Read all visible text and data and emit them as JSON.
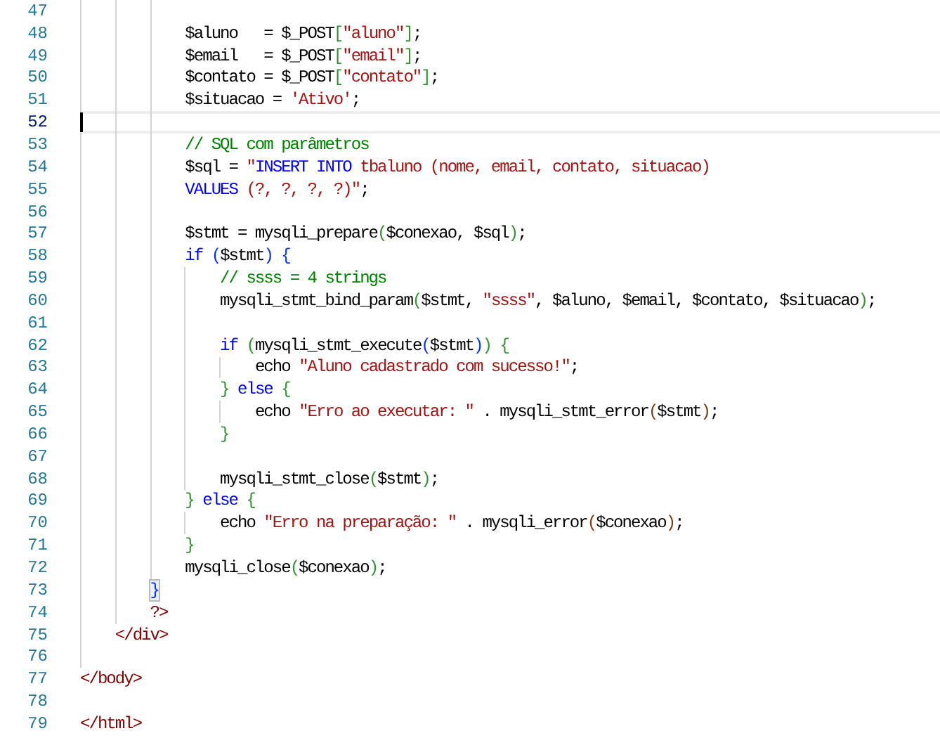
{
  "editor": {
    "lines": [
      {
        "number": "47",
        "current": false
      },
      {
        "number": "48",
        "current": false,
        "tokens": [
          {
            "text": "            $aluno   = $_POST",
            "kind": "plain"
          },
          {
            "text": "[",
            "kind": "bracket2"
          },
          {
            "text": "\"aluno\"",
            "kind": "string"
          },
          {
            "text": "]",
            "kind": "bracket2"
          },
          {
            "text": ";",
            "kind": "plain"
          }
        ]
      },
      {
        "number": "49",
        "current": false,
        "tokens": [
          {
            "text": "            $email   = $_POST",
            "kind": "plain"
          },
          {
            "text": "[",
            "kind": "bracket2"
          },
          {
            "text": "\"email\"",
            "kind": "string"
          },
          {
            "text": "]",
            "kind": "bracket2"
          },
          {
            "text": ";",
            "kind": "plain"
          }
        ]
      },
      {
        "number": "50",
        "current": false,
        "tokens": [
          {
            "text": "            $contato = $_POST",
            "kind": "plain"
          },
          {
            "text": "[",
            "kind": "bracket2"
          },
          {
            "text": "\"contato\"",
            "kind": "string"
          },
          {
            "text": "]",
            "kind": "bracket2"
          },
          {
            "text": ";",
            "kind": "plain"
          }
        ]
      },
      {
        "number": "51",
        "current": false,
        "tokens": [
          {
            "text": "            $situacao = ",
            "kind": "plain"
          },
          {
            "text": "'Ativo'",
            "kind": "string"
          },
          {
            "text": ";",
            "kind": "plain"
          }
        ]
      },
      {
        "number": "52",
        "current": true
      },
      {
        "number": "53",
        "current": false,
        "tokens": [
          {
            "text": "            // SQL com parâmetros",
            "kind": "comment"
          }
        ]
      },
      {
        "number": "54",
        "current": false,
        "tokens": [
          {
            "text": "            $sql = ",
            "kind": "plain"
          },
          {
            "text": "\"",
            "kind": "string"
          },
          {
            "text": "INSERT INTO",
            "kind": "keyword"
          },
          {
            "text": " tbaluno (nome, email, contato, situacao)",
            "kind": "string"
          }
        ]
      },
      {
        "number": "55",
        "current": false,
        "tokens": [
          {
            "text": "            VALUES",
            "kind": "keyword"
          },
          {
            "text": " (?, ?, ?, ?)\"",
            "kind": "string"
          },
          {
            "text": ";",
            "kind": "plain"
          }
        ]
      },
      {
        "number": "56",
        "current": false
      },
      {
        "number": "57",
        "current": false,
        "tokens": [
          {
            "text": "            $stmt = mysqli_prepare",
            "kind": "plain"
          },
          {
            "text": "(",
            "kind": "bracket2"
          },
          {
            "text": "$conexao, $sql",
            "kind": "plain"
          },
          {
            "text": ")",
            "kind": "bracket2"
          },
          {
            "text": ";",
            "kind": "plain"
          }
        ]
      },
      {
        "number": "58",
        "current": false,
        "tokens": [
          {
            "text": "            if ",
            "kind": "keyword"
          },
          {
            "text": "(",
            "kind": "bracket1"
          },
          {
            "text": "$stmt",
            "kind": "plain"
          },
          {
            "text": ")",
            "kind": "bracket1"
          },
          {
            "text": " {",
            "kind": "bracket1"
          }
        ]
      },
      {
        "number": "59",
        "current": false,
        "tokens": [
          {
            "text": "                // ssss = 4 strings",
            "kind": "comment"
          }
        ]
      },
      {
        "number": "60",
        "current": false,
        "tokens": [
          {
            "text": "                mysqli_stmt_bind_param",
            "kind": "plain"
          },
          {
            "text": "(",
            "kind": "bracket2"
          },
          {
            "text": "$stmt, ",
            "kind": "plain"
          },
          {
            "text": "\"ssss\"",
            "kind": "string"
          },
          {
            "text": ", $aluno, $email, $contato, $situacao",
            "kind": "plain"
          },
          {
            "text": ")",
            "kind": "bracket2"
          },
          {
            "text": ";",
            "kind": "plain"
          }
        ]
      },
      {
        "number": "61",
        "current": false
      },
      {
        "number": "62",
        "current": false,
        "tokens": [
          {
            "text": "                if ",
            "kind": "keyword"
          },
          {
            "text": "(",
            "kind": "bracket2"
          },
          {
            "text": "mysqli_stmt_execute",
            "kind": "plain"
          },
          {
            "text": "(",
            "kind": "bracket1"
          },
          {
            "text": "$stmt",
            "kind": "plain"
          },
          {
            "text": ")",
            "kind": "bracket1"
          },
          {
            "text": ")",
            "kind": "bracket2"
          },
          {
            "text": " {",
            "kind": "bracket2"
          }
        ]
      },
      {
        "number": "63",
        "current": false,
        "tokens": [
          {
            "text": "                    echo ",
            "kind": "plain"
          },
          {
            "text": "\"Aluno cadastrado com sucesso!\"",
            "kind": "string"
          },
          {
            "text": ";",
            "kind": "plain"
          }
        ]
      },
      {
        "number": "64",
        "current": false,
        "tokens": [
          {
            "text": "                }",
            "kind": "bracket2"
          },
          {
            "text": " else ",
            "kind": "keyword"
          },
          {
            "text": "{",
            "kind": "bracket2"
          }
        ]
      },
      {
        "number": "65",
        "current": false,
        "tokens": [
          {
            "text": "                    echo ",
            "kind": "plain"
          },
          {
            "text": "\"Erro ao executar: \"",
            "kind": "string"
          },
          {
            "text": " . mysqli_stmt_error",
            "kind": "plain"
          },
          {
            "text": "(",
            "kind": "bracket3"
          },
          {
            "text": "$stmt",
            "kind": "plain"
          },
          {
            "text": ")",
            "kind": "bracket3"
          },
          {
            "text": ";",
            "kind": "plain"
          }
        ]
      },
      {
        "number": "66",
        "current": false,
        "tokens": [
          {
            "text": "                }",
            "kind": "bracket2"
          }
        ]
      },
      {
        "number": "67",
        "current": false
      },
      {
        "number": "68",
        "current": false,
        "tokens": [
          {
            "text": "                mysqli_stmt_close",
            "kind": "plain"
          },
          {
            "text": "(",
            "kind": "bracket2"
          },
          {
            "text": "$stmt",
            "kind": "plain"
          },
          {
            "text": ")",
            "kind": "bracket2"
          },
          {
            "text": ";",
            "kind": "plain"
          }
        ]
      },
      {
        "number": "69",
        "current": false,
        "tokens": [
          {
            "text": "            }",
            "kind": "bracket2"
          },
          {
            "text": " else ",
            "kind": "keyword"
          },
          {
            "text": "{",
            "kind": "bracket2"
          }
        ]
      },
      {
        "number": "70",
        "current": false,
        "tokens": [
          {
            "text": "                echo ",
            "kind": "plain"
          },
          {
            "text": "\"Erro na preparação: \"",
            "kind": "string"
          },
          {
            "text": " . mysqli_error",
            "kind": "plain"
          },
          {
            "text": "(",
            "kind": "bracket3"
          },
          {
            "text": "$conexao",
            "kind": "plain"
          },
          {
            "text": ")",
            "kind": "bracket3"
          },
          {
            "text": ";",
            "kind": "plain"
          }
        ]
      },
      {
        "number": "71",
        "current": false,
        "tokens": [
          {
            "text": "            }",
            "kind": "bracket2"
          }
        ]
      },
      {
        "number": "72",
        "current": false,
        "tokens": [
          {
            "text": "            mysqli_close",
            "kind": "plain"
          },
          {
            "text": "(",
            "kind": "bracket2"
          },
          {
            "text": "$conexao",
            "kind": "plain"
          },
          {
            "text": ")",
            "kind": "bracket2"
          },
          {
            "text": ";",
            "kind": "plain"
          }
        ]
      },
      {
        "number": "73",
        "current": false,
        "tokens": [
          {
            "text": "        }",
            "kind": "matched"
          }
        ]
      },
      {
        "number": "74",
        "current": false,
        "tokens": [
          {
            "text": "        ?>",
            "kind": "tag"
          }
        ]
      },
      {
        "number": "75",
        "current": false,
        "tokens": [
          {
            "text": "    </div>",
            "kind": "tag"
          }
        ]
      },
      {
        "number": "76",
        "current": false
      },
      {
        "number": "77",
        "current": false,
        "tokens": [
          {
            "text": "</body>",
            "kind": "tag"
          }
        ]
      },
      {
        "number": "78",
        "current": false
      },
      {
        "number": "79",
        "current": false,
        "tokens": [
          {
            "text": "</html>",
            "kind": "tag"
          }
        ]
      }
    ]
  }
}
